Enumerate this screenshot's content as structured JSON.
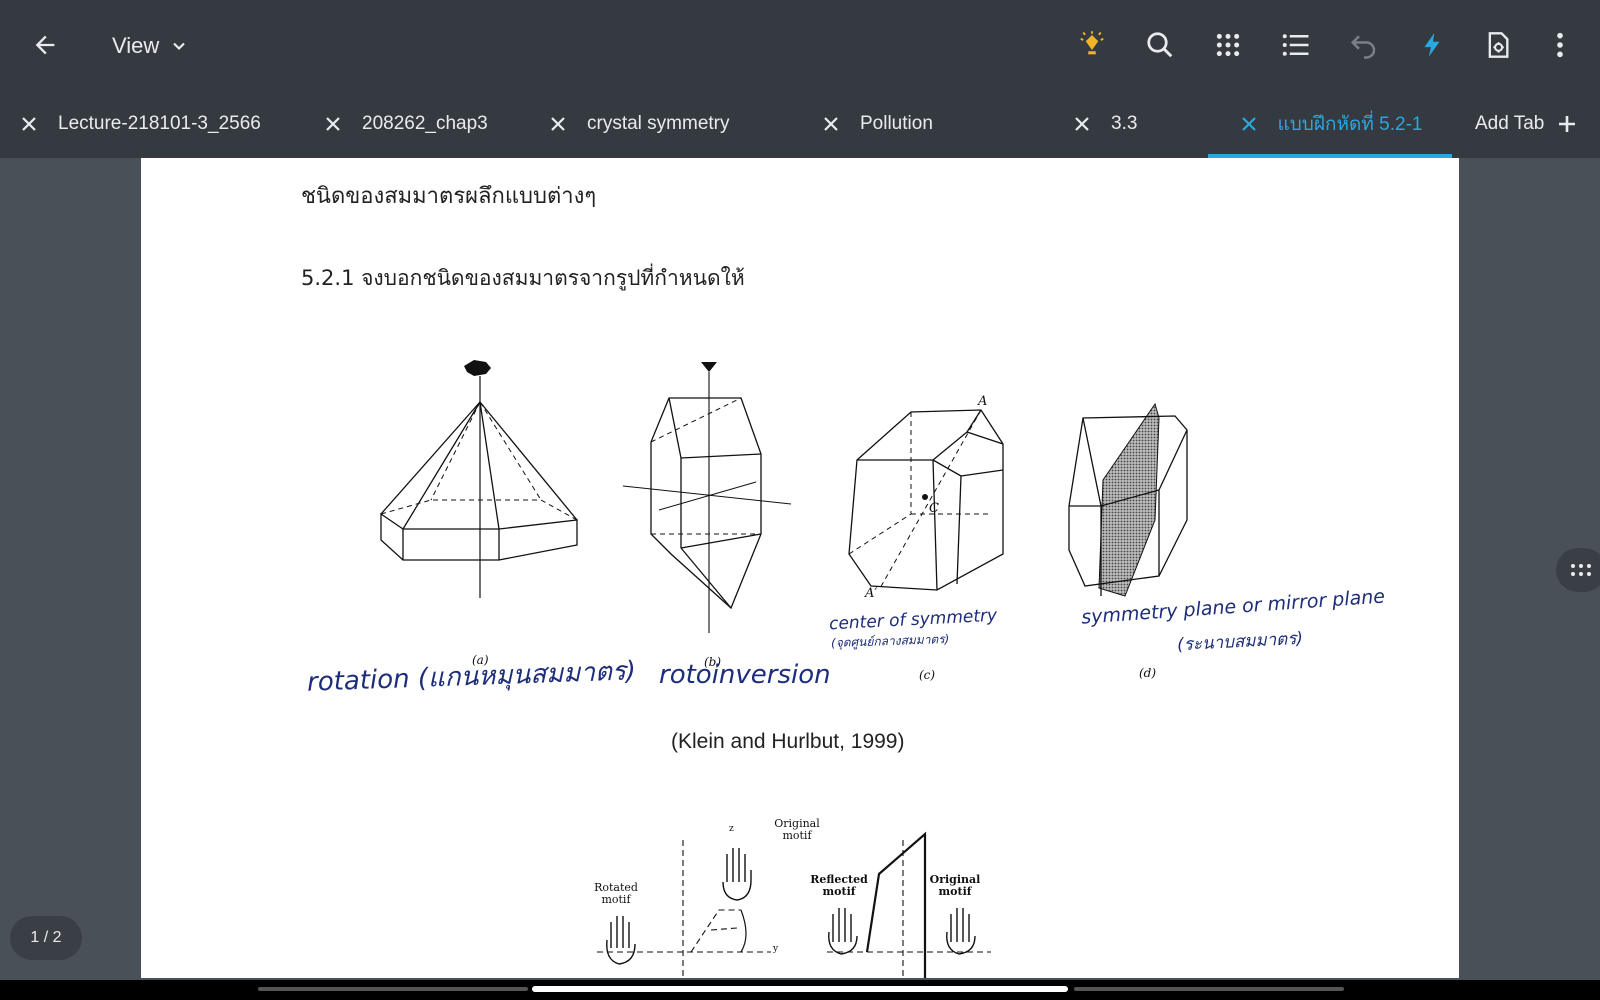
{
  "toolbar": {
    "view_label": "View"
  },
  "tabs": [
    {
      "label": "Lecture-218101-3_2566",
      "active": false
    },
    {
      "label": "208262_chap3",
      "active": false
    },
    {
      "label": "crystal symmetry",
      "active": false
    },
    {
      "label": "Pollution",
      "active": false
    },
    {
      "label": "3.3",
      "active": false
    },
    {
      "label": "แบบฝึกหัดที่ 5.2-1",
      "active": true
    }
  ],
  "add_tab_label": "Add Tab",
  "document": {
    "heading": "ชนิดของสมมาตรผลึกแบบต่างๆ",
    "question": "5.2.1 จงบอกชนิดของสมมาตรจากรูปที่กำหนดให้",
    "figure_captions": [
      "(a)",
      "(b)",
      "(c)",
      "(d)"
    ],
    "point_labels": {
      "a": "A",
      "a_prime": "A′",
      "c": "C"
    },
    "handwritten": {
      "a": "rotation (แกนหมุนสมมาตร)",
      "b": "rotoinversion",
      "c_line1": "center of symmetry",
      "c_line2": "(จุดศูนย์กลางสมมาตร)",
      "d_line1": "symmetry plane or mirror plane",
      "d_line2": "(ระนาบสมมาตร)"
    },
    "citation": "(Klein and Hurlbut, 1999)",
    "lower_figure_labels": {
      "original_motif": "Original motif",
      "rotated_motif": "Rotated motif",
      "reflected_motif": "Reflected motif",
      "original_motif_2": "Original motif",
      "z": "z",
      "y": "y"
    }
  },
  "page_indicator": "1 / 2",
  "colors": {
    "toolbar_bg": "#343a40",
    "accent": "#2aa6e0",
    "ink_blue": "#1d2d7a",
    "bulb": "#f0b429"
  }
}
